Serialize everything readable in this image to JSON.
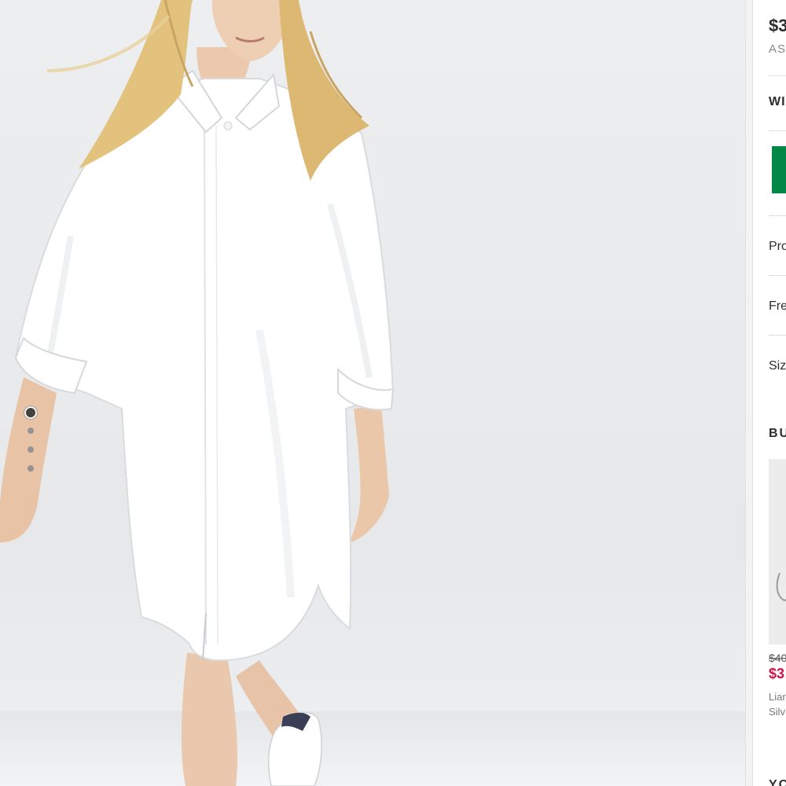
{
  "product": {
    "price": "$3",
    "brand": "AS",
    "color_label": "WI",
    "add_button_label": ""
  },
  "accordion": {
    "product_details": "Pro",
    "free_delivery": "Fre",
    "size_guide": "Siz"
  },
  "gallery": {
    "dot_count": 4,
    "active_index": 0
  },
  "buy_the_look": {
    "heading": "BU",
    "item": {
      "old_price": "$40",
      "new_price": "$3",
      "name_line1": "Liar",
      "name_line2": "Silv"
    }
  },
  "you_might_like": {
    "heading": "YO"
  },
  "colors": {
    "add_button": "#018849",
    "sale_price": "#d01345",
    "text": "#2d2d2d"
  }
}
